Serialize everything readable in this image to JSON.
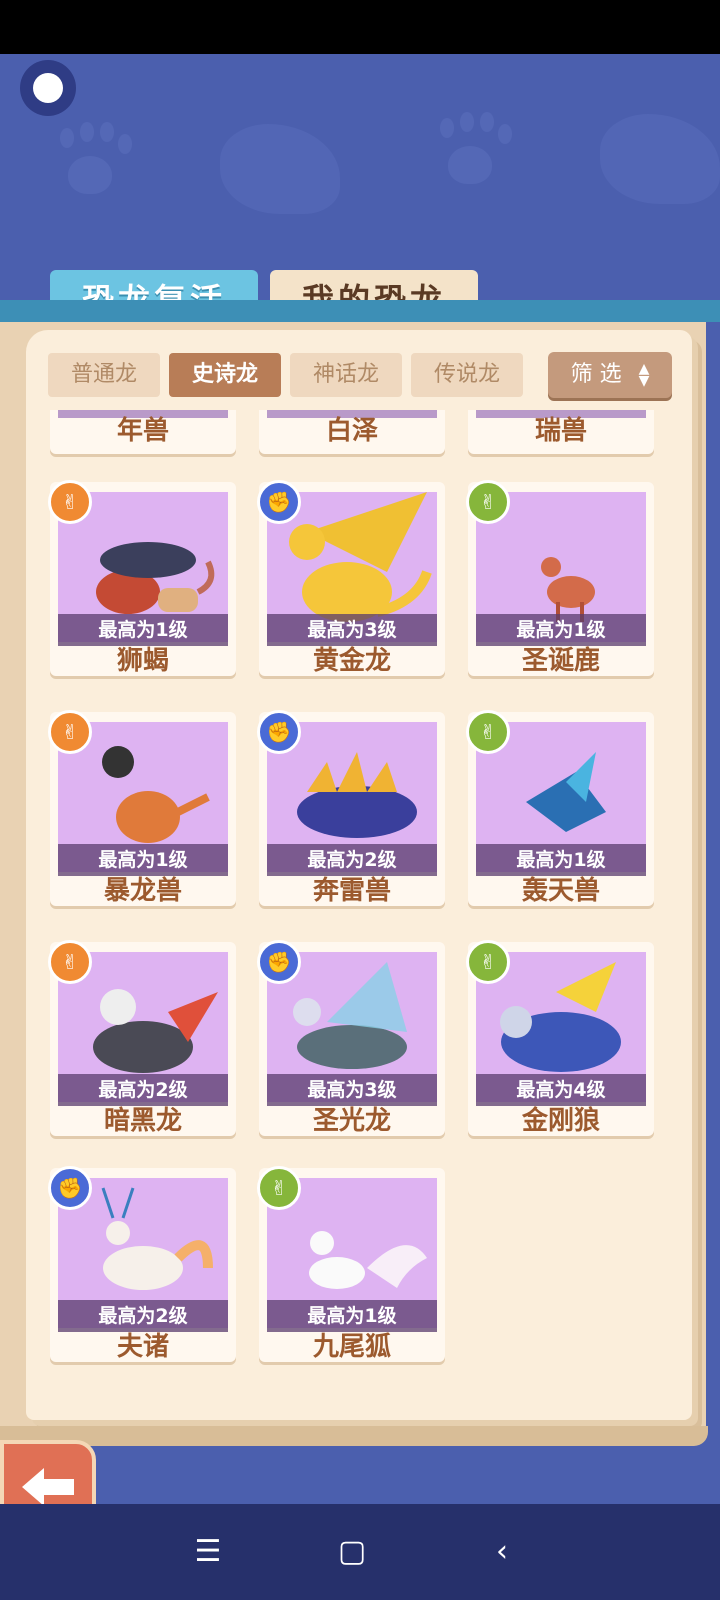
{
  "tabs": {
    "revive_label": "恐龙复活",
    "mine_label": "我的恐龙"
  },
  "filters": {
    "items": [
      "普通龙",
      "史诗龙",
      "神话龙",
      "传说龙"
    ],
    "active": "史诗龙",
    "filter_label": "筛 选"
  },
  "partial_row": [
    "年兽",
    "白泽",
    "瑞兽"
  ],
  "cards": [
    {
      "name": "狮蝎",
      "level": "最高为1级",
      "badge": "orange"
    },
    {
      "name": "黄金龙",
      "level": "最高为3级",
      "badge": "blue"
    },
    {
      "name": "圣诞鹿",
      "level": "最高为1级",
      "badge": "green"
    },
    {
      "name": "暴龙兽",
      "level": "最高为1级",
      "badge": "orange"
    },
    {
      "name": "奔雷兽",
      "level": "最高为2级",
      "badge": "blue"
    },
    {
      "name": "轰天兽",
      "level": "最高为1级",
      "badge": "green"
    },
    {
      "name": "暗黑龙",
      "level": "最高为2级",
      "badge": "orange"
    },
    {
      "name": "圣光龙",
      "level": "最高为3级",
      "badge": "blue"
    },
    {
      "name": "金刚狼",
      "level": "最高为4级",
      "badge": "green"
    },
    {
      "name": "夫诸",
      "level": "最高为2级",
      "badge": "blue"
    },
    {
      "name": "九尾狐",
      "level": "最高为1级",
      "badge": "green"
    }
  ],
  "colors": {
    "accent": "#b87d57",
    "card_bg": "#deb3f2",
    "name_color": "#9c5a2e"
  },
  "icons": {
    "home": "home-circle-icon",
    "back": "back-arrow-icon",
    "nav": [
      "menu-icon",
      "home-square-icon",
      "back-chevron-icon"
    ]
  }
}
